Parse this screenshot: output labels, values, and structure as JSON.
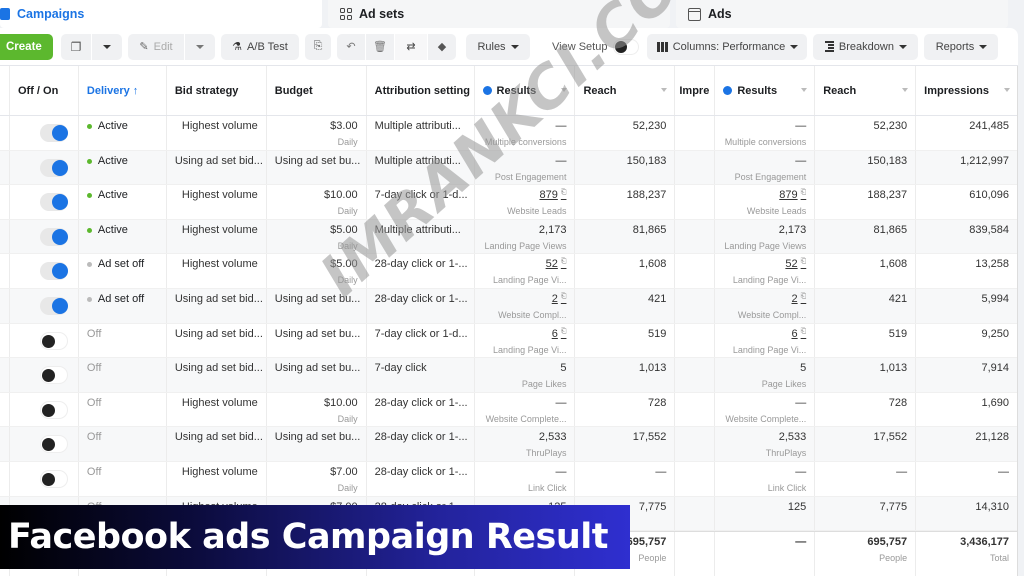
{
  "tabs": {
    "campaigns": "Campaigns",
    "adsets": "Ad sets",
    "ads": "Ads"
  },
  "toolbar": {
    "create": "Create",
    "edit": "Edit",
    "ab_test": "A/B Test",
    "rules": "Rules",
    "view_setup": "View Setup",
    "columns": "Columns: Performance",
    "breakdown": "Breakdown",
    "reports": "Reports"
  },
  "columns": {
    "toggle": "Off / On",
    "delivery": "Delivery ↑",
    "bid_strategy": "Bid strategy",
    "budget": "Budget",
    "attribution": "Attribution setting",
    "results": "Results",
    "reach": "Reach",
    "impressions_short": "Impre",
    "results2": "Results",
    "reach2": "Reach",
    "impressions": "Impressions"
  },
  "rows": [
    {
      "on": true,
      "status": "Active",
      "status_color": "#5cb82e",
      "bid": "Highest volume",
      "budget": "$3.00",
      "budget_sub": "Daily",
      "attribution": "Multiple attributi...",
      "results": "—",
      "results_link": false,
      "results_sub": "Multiple conversions",
      "reach": "52,230",
      "impressions": "241,485"
    },
    {
      "on": true,
      "status": "Active",
      "status_color": "#5cb82e",
      "bid": "Using ad set bid...",
      "budget": "Using ad set bu...",
      "budget_sub": "",
      "attribution": "Multiple attributi...",
      "results": "—",
      "results_link": false,
      "results_sub": "Post Engagement",
      "reach": "150,183",
      "impressions": "1,212,997"
    },
    {
      "on": true,
      "status": "Active",
      "status_color": "#5cb82e",
      "bid": "Highest volume",
      "budget": "$10.00",
      "budget_sub": "Daily",
      "attribution": "7-day click or 1-d...",
      "results": "879",
      "results_link": true,
      "results_sub": "Website Leads",
      "reach": "188,237",
      "impressions": "610,096"
    },
    {
      "on": true,
      "status": "Active",
      "status_color": "#5cb82e",
      "bid": "Highest volume",
      "budget": "$5.00",
      "budget_sub": "Daily",
      "attribution": "Multiple attributi...",
      "results": "2,173",
      "results_link": false,
      "results_sub": "Landing Page Views",
      "reach": "81,865",
      "impressions": "839,584"
    },
    {
      "on": true,
      "status": "Ad set off",
      "status_color": "#bbbbbb",
      "bid": "Highest volume",
      "budget": "$5.00",
      "budget_sub": "Daily",
      "attribution": "28-day click or 1-...",
      "results": "52",
      "results_link": true,
      "results_sub": "Landing Page Vi...",
      "reach": "1,608",
      "impressions": "13,258"
    },
    {
      "on": true,
      "status": "Ad set off",
      "status_color": "#bbbbbb",
      "bid": "Using ad set bid...",
      "budget": "Using ad set bu...",
      "budget_sub": "",
      "attribution": "28-day click or 1-...",
      "results": "2",
      "results_link": true,
      "results_sub": "Website Compl...",
      "reach": "421",
      "impressions": "5,994"
    },
    {
      "on": false,
      "status": "Off",
      "status_color": "",
      "bid": "Using ad set bid...",
      "budget": "Using ad set bu...",
      "budget_sub": "",
      "attribution": "7-day click or 1-d...",
      "results": "6",
      "results_link": true,
      "results_sub": "Landing Page Vi...",
      "reach": "519",
      "impressions": "9,250"
    },
    {
      "on": false,
      "status": "Off",
      "status_color": "",
      "bid": "Using ad set bid...",
      "budget": "Using ad set bu...",
      "budget_sub": "",
      "attribution": "7-day click",
      "results": "5",
      "results_link": false,
      "results_sub": "Page Likes",
      "reach": "1,013",
      "impressions": "7,914"
    },
    {
      "on": false,
      "status": "Off",
      "status_color": "",
      "bid": "Highest volume",
      "budget": "$10.00",
      "budget_sub": "Daily",
      "attribution": "28-day click or 1-...",
      "results": "—",
      "results_link": false,
      "results_sub": "Website Complete...",
      "reach": "728",
      "impressions": "1,690"
    },
    {
      "on": false,
      "status": "Off",
      "status_color": "",
      "bid": "Using ad set bid...",
      "budget": "Using ad set bu...",
      "budget_sub": "",
      "attribution": "28-day click or 1-...",
      "results": "2,533",
      "results_link": false,
      "results_sub": "ThruPlays",
      "reach": "17,552",
      "impressions": "21,128"
    },
    {
      "on": false,
      "status": "Off",
      "status_color": "",
      "bid": "Highest volume",
      "budget": "$7.00",
      "budget_sub": "Daily",
      "attribution": "28-day click or 1-...",
      "results": "—",
      "results_link": false,
      "results_sub": "Link Click",
      "reach": "—",
      "impressions": "—"
    },
    {
      "on": false,
      "status": "Off",
      "status_color": "",
      "bid": "Highest volume",
      "budget": "$7.00",
      "budget_sub": "",
      "attribution": "28-day click or 1-...",
      "results": "125",
      "results_link": false,
      "results_sub": "",
      "reach": "7,775",
      "impressions": "14,310"
    }
  ],
  "totals": {
    "results": "—",
    "reach": "695,757",
    "reach_sub": "People",
    "results2": "—",
    "reach2": "695,757",
    "reach2_sub": "People",
    "impressions": "3,436,177",
    "impressions_sub": "Total"
  },
  "watermark": "IMRANKCI.COM",
  "banner": "Facebook ads Campaign Result"
}
